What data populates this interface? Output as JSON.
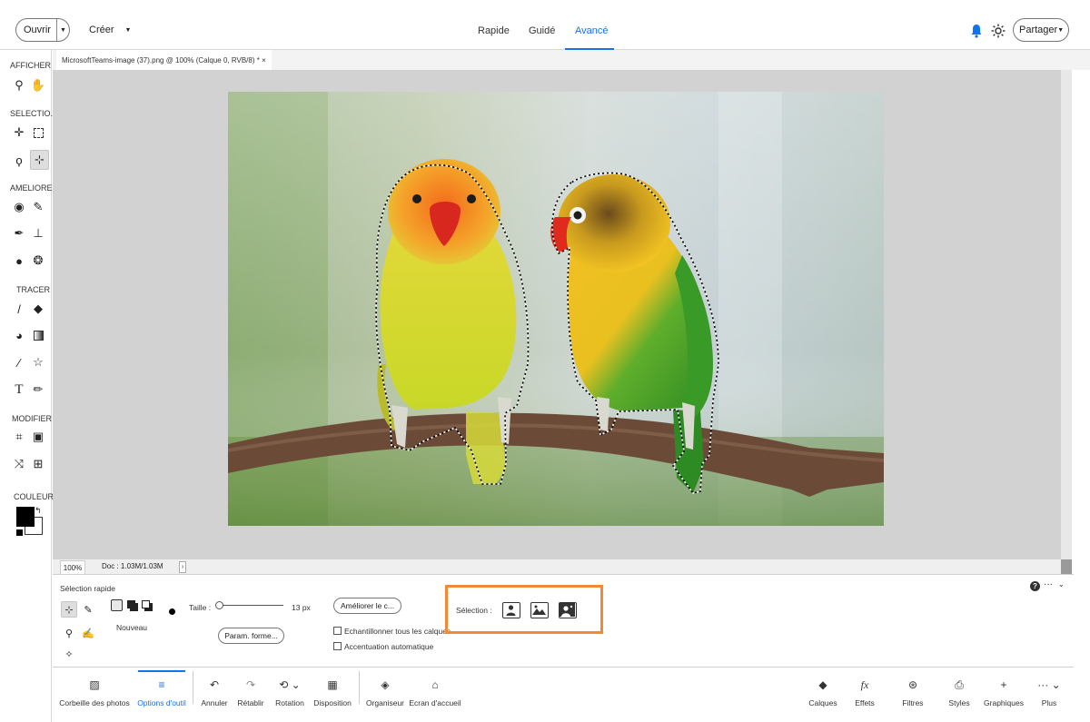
{
  "topbar": {
    "open_label": "Ouvrir",
    "create_label": "Créer",
    "modes": [
      "Rapide",
      "Guidé",
      "Avancé"
    ],
    "active_mode": "Avancé",
    "share_label": "Partager",
    "accent": "#1473e6"
  },
  "left_toolbar": {
    "sections": [
      "AFFICHER",
      "SELECTIO...",
      "AMELIORER",
      "TRACER",
      "MODIFIER",
      "COULEUR"
    ],
    "icons": [
      "zoom-icon",
      "hand-icon",
      "move-icon",
      "marquee-icon",
      "lasso-icon",
      "quick-selection-icon",
      "red-eye-icon",
      "spot-healing-icon",
      "smart-brush-icon",
      "clone-stamp-icon",
      "blur-icon",
      "sponge-icon",
      "brush-icon",
      "eraser-icon",
      "paint-bucket-icon",
      "gradient-icon",
      "eyedropper-icon",
      "custom-shape-icon",
      "type-icon",
      "pencil-icon",
      "crop-icon",
      "recompose-icon",
      "content-aware-move-icon",
      "straighten-icon"
    ],
    "foreground_color": "#000000",
    "background_color": "#ffffff"
  },
  "document": {
    "tab_title": "MicrosoftTeams-image (37).png @ 100% (Calque 0, RVB/8) * ×",
    "zoom": "100%",
    "doc_size": "Doc : 1.03M/1.03M"
  },
  "options": {
    "tool_name": "Sélection rapide",
    "mode_label": "Nouveau",
    "size_label": "Taille :",
    "size_value": "13 px",
    "refine_button": "Améliorer le c...",
    "brush_settings_button": "Param. forme...",
    "sample_all_layers": "Echantillonner tous les calques",
    "auto_enhance": "Accentuation automatique",
    "selection_label": "Sélection :",
    "highlight_color": "#f08a38"
  },
  "bottombar": {
    "items": [
      "Corbeille des photos",
      "Options d'outil",
      "Annuler",
      "Rétablir",
      "Rotation",
      "Disposition",
      "Organiseur",
      "Ecran d'accueil",
      "Calques",
      "Effets",
      "Filtres",
      "Styles",
      "Graphiques",
      "Plus"
    ],
    "active_item": "Options d'outil"
  }
}
